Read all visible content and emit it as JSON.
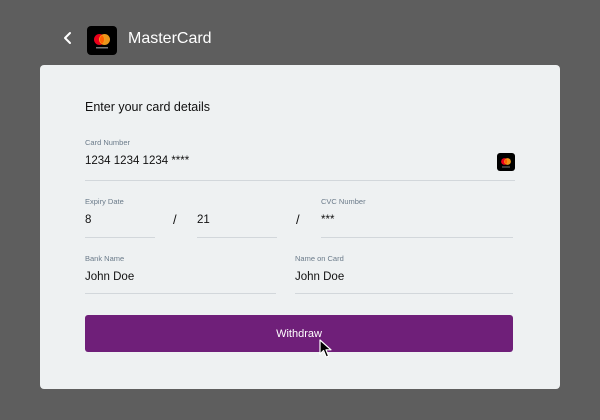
{
  "header": {
    "title": "MasterCard",
    "back_icon": "chevron-left-icon",
    "logo_icon": "mastercard-logo-icon"
  },
  "card": {
    "section_title": "Enter your card details",
    "card_number": {
      "label": "Card Number",
      "value": "1234 1234 1234 ****",
      "brand_icon": "mastercard-logo-icon"
    },
    "expiry": {
      "label": "Expiry Date",
      "month": "8",
      "separator": "/",
      "year": "21"
    },
    "cvc": {
      "separator": "/",
      "label": "CVC Number",
      "value": "***"
    },
    "bank_name": {
      "label": "Bank Name",
      "value": "John Doe"
    },
    "name_on_card": {
      "label": "Name on Card",
      "value": "John Doe"
    },
    "withdraw_label": "Withdraw"
  },
  "colors": {
    "background": "#5e5e5e",
    "card": "#eef1f2",
    "accent": "#6f1f79",
    "mc_red": "#eb001b",
    "mc_orange": "#f79e1b"
  }
}
